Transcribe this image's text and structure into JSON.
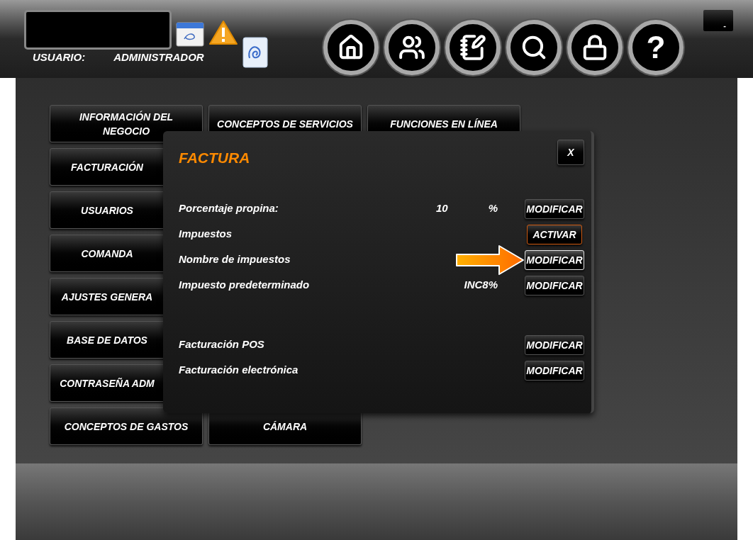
{
  "header": {
    "user_label": "USUARIO:",
    "user_name": "ADMINISTRADOR",
    "nav": [
      {
        "kind": "home"
      },
      {
        "kind": "users"
      },
      {
        "kind": "notes"
      },
      {
        "kind": "search"
      },
      {
        "kind": "lock"
      },
      {
        "kind": "help",
        "label": "?"
      }
    ],
    "minimize": "-"
  },
  "menu": {
    "column_1": [
      "INFORMACIÓN DEL NEGOCIO",
      "FACTURACIÓN",
      "USUARIOS",
      "COMANDA",
      "AJUSTES GENERA",
      "BASE DE DATOS",
      "CONTRASEÑA ADM",
      "CONCEPTOS DE GASTOS"
    ],
    "column_2_top": "CONCEPTOS DE SERVICIOS",
    "column_2_bottom": "CÁMARA",
    "column_3_top": "FUNCIONES EN LÍNEA"
  },
  "dialog": {
    "title": "FACTURA",
    "close": "X",
    "groups": [
      [
        {
          "label": "Porcentaje propina:",
          "value": "10",
          "unit": "%",
          "button": {
            "kind": "modify",
            "label": "MODIFICAR",
            "highlighted": false
          }
        },
        {
          "label": "Impuestos",
          "button": {
            "kind": "activate",
            "label": "ACTIVAR",
            "highlighted": false
          }
        },
        {
          "label": "Nombre de impuestos",
          "button": {
            "kind": "modify",
            "label": "MODIFICAR",
            "highlighted": true
          }
        },
        {
          "label": "Impuesto predeterminado",
          "value": "INC8%",
          "button": {
            "kind": "modify",
            "label": "MODIFICAR",
            "highlighted": false
          }
        }
      ],
      [
        {
          "label": "Facturación POS",
          "button": {
            "kind": "modify",
            "label": "MODIFICAR",
            "highlighted": false
          }
        },
        {
          "label": "Facturación electrónica",
          "button": {
            "kind": "modify",
            "label": "MODIFICAR",
            "highlighted": false
          }
        }
      ]
    ]
  }
}
